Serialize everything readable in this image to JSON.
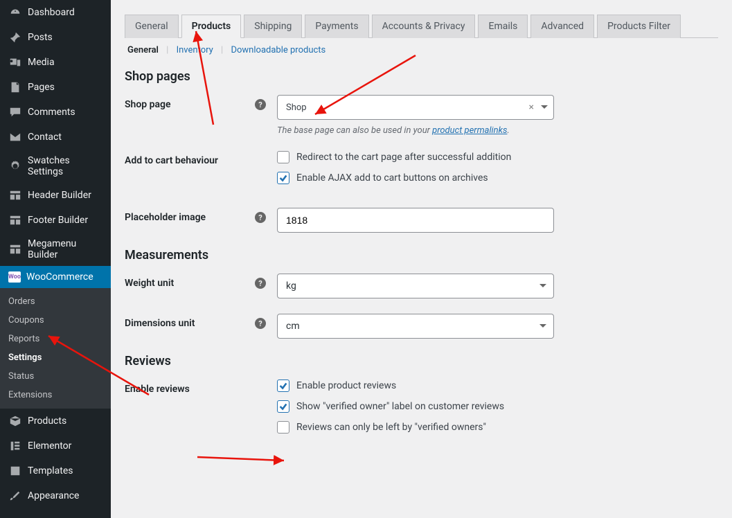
{
  "sidebar": {
    "items": [
      {
        "label": "Dashboard",
        "icon": "dashboard"
      },
      {
        "label": "Posts",
        "icon": "pin"
      },
      {
        "label": "Media",
        "icon": "media"
      },
      {
        "label": "Pages",
        "icon": "page"
      },
      {
        "label": "Comments",
        "icon": "comment"
      },
      {
        "label": "Contact",
        "icon": "mail"
      },
      {
        "label": "Swatches Settings",
        "icon": "gear"
      },
      {
        "label": "Header Builder",
        "icon": "grid"
      },
      {
        "label": "Footer Builder",
        "icon": "grid"
      },
      {
        "label": "Megamenu Builder",
        "icon": "grid"
      },
      {
        "label": "WooCommerce",
        "icon": "woo",
        "current": true
      },
      {
        "label": "Products",
        "icon": "box"
      },
      {
        "label": "Elementor",
        "icon": "elementor"
      },
      {
        "label": "Templates",
        "icon": "template"
      },
      {
        "label": "Appearance",
        "icon": "brush"
      }
    ],
    "submenu": [
      {
        "label": "Orders"
      },
      {
        "label": "Coupons"
      },
      {
        "label": "Reports"
      },
      {
        "label": "Settings",
        "active": true
      },
      {
        "label": "Status"
      },
      {
        "label": "Extensions"
      }
    ]
  },
  "tabs": [
    "General",
    "Products",
    "Shipping",
    "Payments",
    "Accounts & Privacy",
    "Emails",
    "Advanced",
    "Products Filter"
  ],
  "activeTab": "Products",
  "subtabs": {
    "general": "General",
    "inventory": "Inventory",
    "downloadable": "Downloadable products"
  },
  "sections": {
    "shopPages": "Shop pages",
    "measurements": "Measurements",
    "reviews": "Reviews"
  },
  "fields": {
    "shopPage": {
      "label": "Shop page",
      "value": "Shop",
      "desc_pre": "The base page can also be used in your ",
      "desc_link": "product permalinks",
      "desc_post": "."
    },
    "addToCart": {
      "label": "Add to cart behaviour",
      "opt1": "Redirect to the cart page after successful addition",
      "opt2": "Enable AJAX add to cart buttons on archives"
    },
    "placeholder": {
      "label": "Placeholder image",
      "value": "1818"
    },
    "weight": {
      "label": "Weight unit",
      "value": "kg"
    },
    "dimensions": {
      "label": "Dimensions unit",
      "value": "cm"
    },
    "reviews": {
      "label": "Enable reviews",
      "opt1": "Enable product reviews",
      "opt2": "Show \"verified owner\" label on customer reviews",
      "opt3": "Reviews can only be left by \"verified owners\""
    }
  }
}
